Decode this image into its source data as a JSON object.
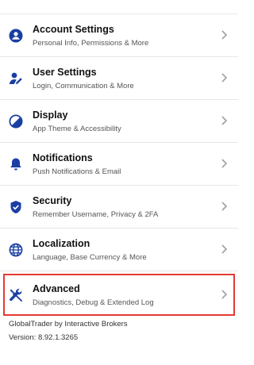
{
  "settings": {
    "items": [
      {
        "title": "Account Settings",
        "subtitle": "Personal Info, Permissions & More",
        "icon": "account-icon"
      },
      {
        "title": "User Settings",
        "subtitle": "Login, Communication & More",
        "icon": "user-edit-icon"
      },
      {
        "title": "Display",
        "subtitle": "App Theme & Accessibility",
        "icon": "display-icon"
      },
      {
        "title": "Notifications",
        "subtitle": "Push Notifications & Email",
        "icon": "bell-icon"
      },
      {
        "title": "Security",
        "subtitle": "Remember Username, Privacy & 2FA",
        "icon": "shield-icon"
      },
      {
        "title": "Localization",
        "subtitle": "Language, Base Currency & More",
        "icon": "globe-icon"
      },
      {
        "title": "Advanced",
        "subtitle": "Diagnostics, Debug & Extended Log",
        "icon": "wrench-screwdriver-icon"
      }
    ]
  },
  "footer": {
    "app_name": "GlobalTrader by Interactive Brokers",
    "version": "Version: 8.92.1.3265"
  },
  "colors": {
    "icon": "#1a3fa3",
    "highlight_border": "#e53935",
    "chevron": "#a0a0a0"
  }
}
